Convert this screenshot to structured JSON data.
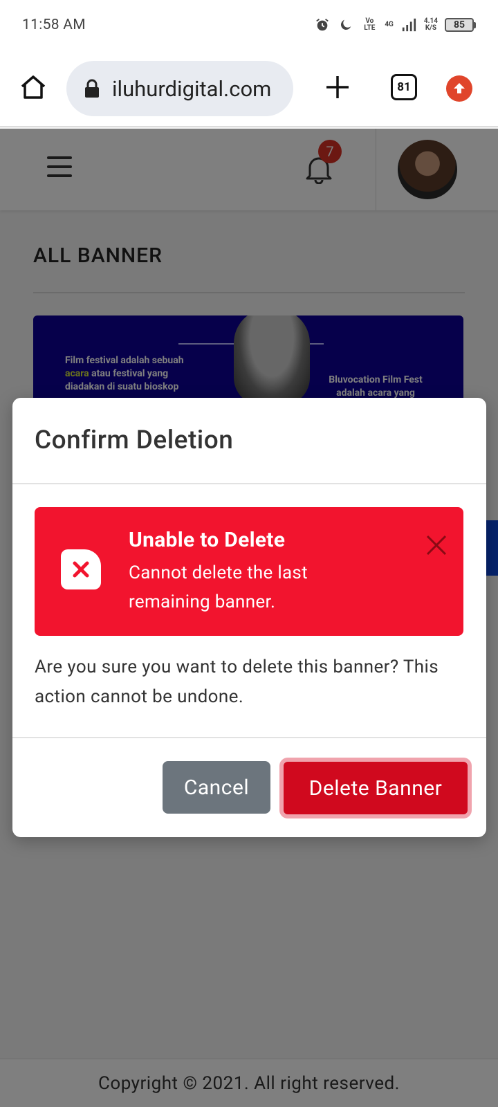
{
  "status_bar": {
    "time": "11:58 AM",
    "net_volte": "Vo LTE",
    "net_type": "4G",
    "speed": "4.14",
    "speed_unit": "K/S",
    "battery": "85"
  },
  "browser": {
    "url": "iluhurdigital.com",
    "tab_count": "81"
  },
  "header": {
    "notification_count": "7"
  },
  "page": {
    "title": "ALL BANNER",
    "banner": {
      "left_text_pre": "Film festival adalah sebuah ",
      "left_text_hl": "acara",
      "left_text_post": " atau festival yang diadakan di suatu bioskop",
      "right_text": "Bluvocation Film Fest adalah acara yang"
    }
  },
  "modal": {
    "title": "Confirm Deletion",
    "alert_title": "Unable to Delete",
    "alert_message": "Cannot delete the last remaining banner.",
    "body": "Are you sure you want to delete this banner? This action cannot be undone.",
    "cancel_label": "Cancel",
    "delete_label": "Delete Banner"
  },
  "footer": {
    "text": "Copyright © 2021. All right reserved."
  },
  "colors": {
    "alert_bg": "#f2142e",
    "delete_button": "#d0091e",
    "cancel_button": "#6c757d",
    "banner_bg": "#0d0096",
    "badge": "#d93025"
  }
}
